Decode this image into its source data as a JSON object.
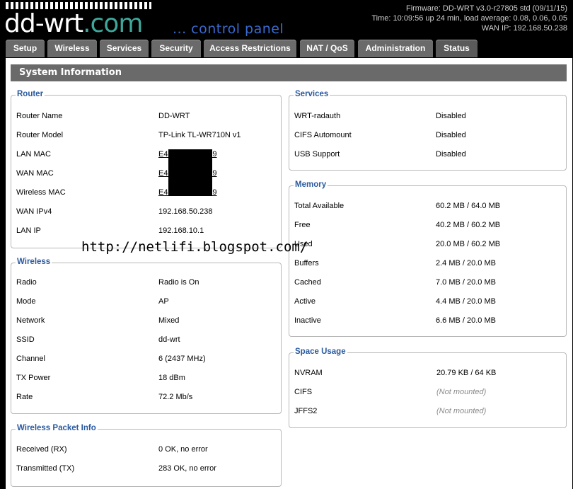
{
  "header": {
    "logo_word": "dd-wrt",
    "logo_suffix": ".com",
    "subtitle": "... control panel",
    "firmware": "Firmware: DD-WRT v3.0-r27805 std (09/11/15)",
    "time": "Time: 10:09:56 up 24 min, load average: 0.08, 0.06, 0.05",
    "wan_ip": "WAN IP: 192.168.50.238"
  },
  "tabs": [
    "Setup",
    "Wireless",
    "Services",
    "Security",
    "Access Restrictions",
    "NAT / QoS",
    "Administration",
    "Status"
  ],
  "page_title": "System Information",
  "router": {
    "legend": "Router",
    "rows": [
      {
        "label": "Router Name",
        "value": "DD-WRT"
      },
      {
        "label": "Router Model",
        "value": "TP-Link TL-WR710N v1"
      },
      {
        "label": "LAN MAC",
        "value": "E4:                :D9"
      },
      {
        "label": "WAN MAC",
        "value": "E4:                :D9"
      },
      {
        "label": "Wireless MAC",
        "value": "E4:                :D9"
      },
      {
        "label": "WAN IPv4",
        "value": "192.168.50.238"
      },
      {
        "label": "LAN IP",
        "value": "192.168.10.1"
      }
    ]
  },
  "wireless": {
    "legend": "Wireless",
    "rows": [
      {
        "label": "Radio",
        "value": "Radio is On"
      },
      {
        "label": "Mode",
        "value": "AP"
      },
      {
        "label": "Network",
        "value": "Mixed"
      },
      {
        "label": "SSID",
        "value": "dd-wrt"
      },
      {
        "label": "Channel",
        "value": "6 (2437 MHz)"
      },
      {
        "label": "TX Power",
        "value": "18 dBm"
      },
      {
        "label": "Rate",
        "value": "72.2 Mb/s"
      }
    ]
  },
  "packet_info": {
    "legend": "Wireless Packet Info",
    "rows": [
      {
        "label": "Received (RX)",
        "value": "0 OK, no error"
      },
      {
        "label": "Transmitted (TX)",
        "value": "283 OK, no error"
      }
    ]
  },
  "services": {
    "legend": "Services",
    "rows": [
      {
        "label": "WRT-radauth",
        "value": "Disabled"
      },
      {
        "label": "CIFS Automount",
        "value": "Disabled"
      },
      {
        "label": "USB Support",
        "value": "Disabled"
      }
    ]
  },
  "memory": {
    "legend": "Memory",
    "rows": [
      {
        "label": "Total Available",
        "value": "60.2 MB / 64.0 MB"
      },
      {
        "label": "Free",
        "value": "40.2 MB / 60.2 MB"
      },
      {
        "label": "Used",
        "value": "20.0 MB / 60.2 MB"
      },
      {
        "label": "Buffers",
        "value": "2.4 MB / 20.0 MB"
      },
      {
        "label": "Cached",
        "value": "7.0 MB / 20.0 MB"
      },
      {
        "label": "Active",
        "value": "4.4 MB / 20.0 MB"
      },
      {
        "label": "Inactive",
        "value": "6.6 MB / 20.0 MB"
      }
    ]
  },
  "space": {
    "legend": "Space Usage",
    "rows": [
      {
        "label": "NVRAM",
        "value": "20.79 KB / 64 KB"
      },
      {
        "label": "CIFS",
        "value": "(Not mounted)"
      },
      {
        "label": "JFFS2",
        "value": "(Not mounted)"
      }
    ]
  },
  "watermark": "http://netlifi.blogspot.com/"
}
